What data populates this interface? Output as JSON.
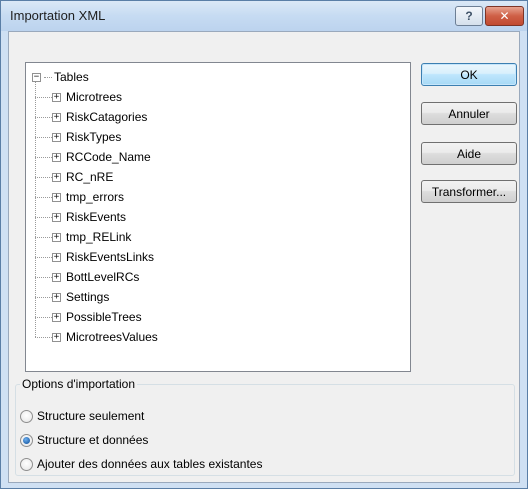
{
  "window": {
    "title": "Importation XML",
    "help_label": "?",
    "close_label": "✕"
  },
  "tree": {
    "root_label": "Tables",
    "root_expander": "−",
    "child_expander": "+",
    "items": [
      "Microtrees",
      "RiskCatagories",
      "RiskTypes",
      "RCCode_Name",
      "RC_nRE",
      "tmp_errors",
      "RiskEvents",
      "tmp_RELink",
      "RiskEventsLinks",
      "BottLevelRCs",
      "Settings",
      "PossibleTrees",
      "MicrotreesValues"
    ]
  },
  "buttons": {
    "ok": "OK",
    "cancel": "Annuler",
    "help": "Aide",
    "transform": "Transformer..."
  },
  "options": {
    "legend": "Options d'importation",
    "choices": [
      {
        "label": "Structure seulement",
        "checked": false
      },
      {
        "label": "Structure et données",
        "checked": true
      },
      {
        "label": "Ajouter des données aux tables existantes",
        "checked": false
      }
    ]
  },
  "colors": {
    "title_bar": "#c6dbf2",
    "close_button": "#c14a30",
    "default_button": "#bee6fd"
  }
}
